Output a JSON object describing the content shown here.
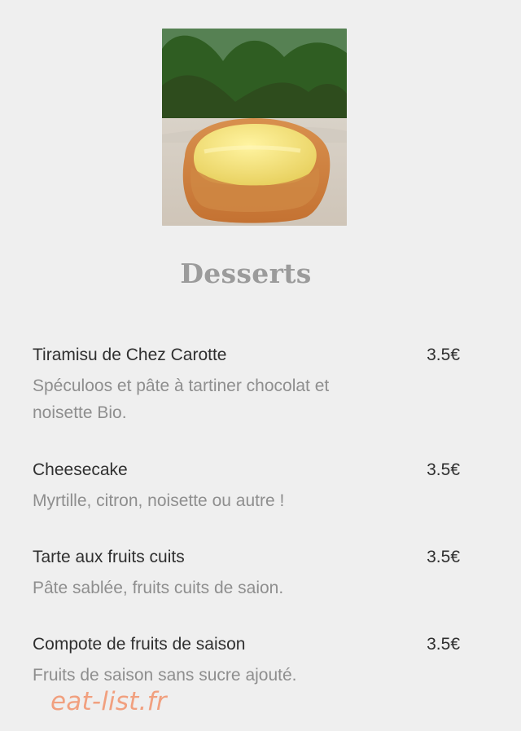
{
  "hero": {
    "alt": "Tartelette au citron"
  },
  "menu": {
    "title": "Desserts",
    "items": [
      {
        "name": "Tiramisu de Chez Carotte",
        "price": "3.5€",
        "description": "Spéculoos et pâte à tartiner chocolat et noisette Bio."
      },
      {
        "name": "Cheesecake",
        "price": "3.5€",
        "description": "Myrtille, citron, noisette ou autre !"
      },
      {
        "name": "Tarte aux fruits cuits",
        "price": "3.5€",
        "description": "Pâte sablée, fruits cuits de saion."
      },
      {
        "name": "Compote de fruits de saison",
        "price": "3.5€",
        "description": "Fruits de saison sans sucre ajouté."
      }
    ]
  },
  "watermark": "eat-list.fr",
  "colors": {
    "background": "#efefef",
    "title": "#9b9b9b",
    "item_text": "#2f2f2f",
    "description_text": "#8e8e8e",
    "watermark": "#f1a07f"
  }
}
